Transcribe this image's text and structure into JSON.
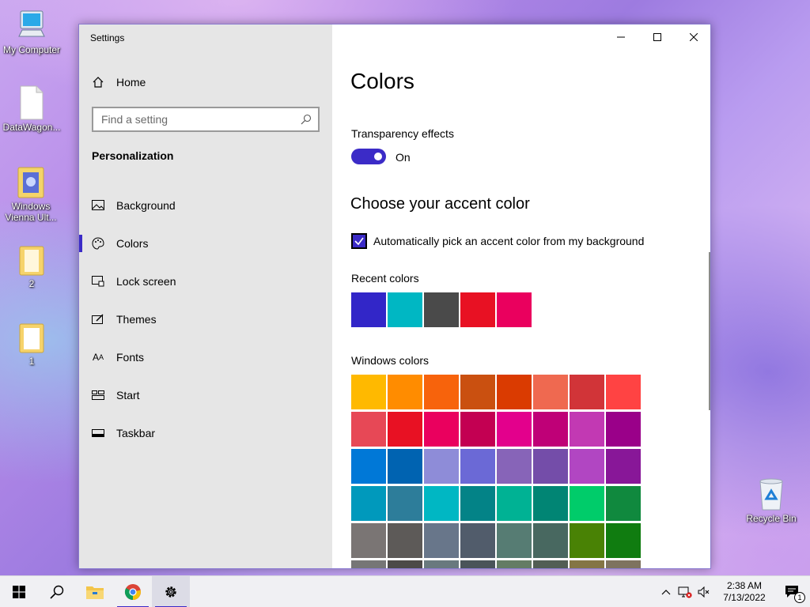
{
  "desktop": {
    "icons": [
      {
        "label": "My Computer"
      },
      {
        "label": "DataWagon..."
      },
      {
        "label": "Windows Vienna Ult..."
      },
      {
        "label": "2"
      },
      {
        "label": "1"
      },
      {
        "label": "Recycle Bin"
      }
    ]
  },
  "window": {
    "title": "Settings"
  },
  "sidebar": {
    "home_label": "Home",
    "search_placeholder": "Find a setting",
    "section": "Personalization",
    "items": [
      {
        "label": "Background",
        "icon": "picture-icon"
      },
      {
        "label": "Colors",
        "icon": "palette-icon",
        "active": true
      },
      {
        "label": "Lock screen",
        "icon": "lock-screen-icon"
      },
      {
        "label": "Themes",
        "icon": "themes-icon"
      },
      {
        "label": "Fonts",
        "icon": "fonts-icon"
      },
      {
        "label": "Start",
        "icon": "start-icon"
      },
      {
        "label": "Taskbar",
        "icon": "taskbar-icon"
      }
    ]
  },
  "main": {
    "title": "Colors",
    "transparency_label": "Transparency effects",
    "transparency_state": "On",
    "accent_heading": "Choose your accent color",
    "auto_accent_label": "Automatically pick an accent color from my background",
    "auto_accent_checked": true,
    "recent_label": "Recent colors",
    "recent_colors": [
      "#3226c8",
      "#00b7c3",
      "#4a4a4a",
      "#e81123",
      "#ea005e"
    ],
    "windows_label": "Windows colors",
    "windows_colors": [
      [
        "#ffb900",
        "#ff8c00",
        "#f7630c",
        "#ca5010",
        "#da3b01",
        "#ef6950",
        "#d13438",
        "#ff4343"
      ],
      [
        "#e74856",
        "#e81123",
        "#ea005e",
        "#c30052",
        "#e3008c",
        "#bf0077",
        "#c239b3",
        "#9a0089"
      ],
      [
        "#0078d7",
        "#0063b1",
        "#8e8cd8",
        "#6b69d6",
        "#8764b8",
        "#744da9",
        "#b146c2",
        "#881798"
      ],
      [
        "#0099bc",
        "#2d7d9a",
        "#00b7c3",
        "#038387",
        "#00b294",
        "#018574",
        "#00cc6a",
        "#10893e"
      ],
      [
        "#7a7574",
        "#5d5a58",
        "#68768a",
        "#515c6b",
        "#567c73",
        "#486860",
        "#498205",
        "#107c10"
      ],
      [
        "#767676",
        "#4c4a48",
        "#69797e",
        "#4a5459",
        "#647c64",
        "#525e54",
        "#847545",
        "#7e735f"
      ]
    ]
  },
  "taskbar": {
    "time": "2:38 AM",
    "date": "7/13/2022",
    "notification_count": "1"
  },
  "colors": {
    "accent": "#3b2bc7"
  }
}
